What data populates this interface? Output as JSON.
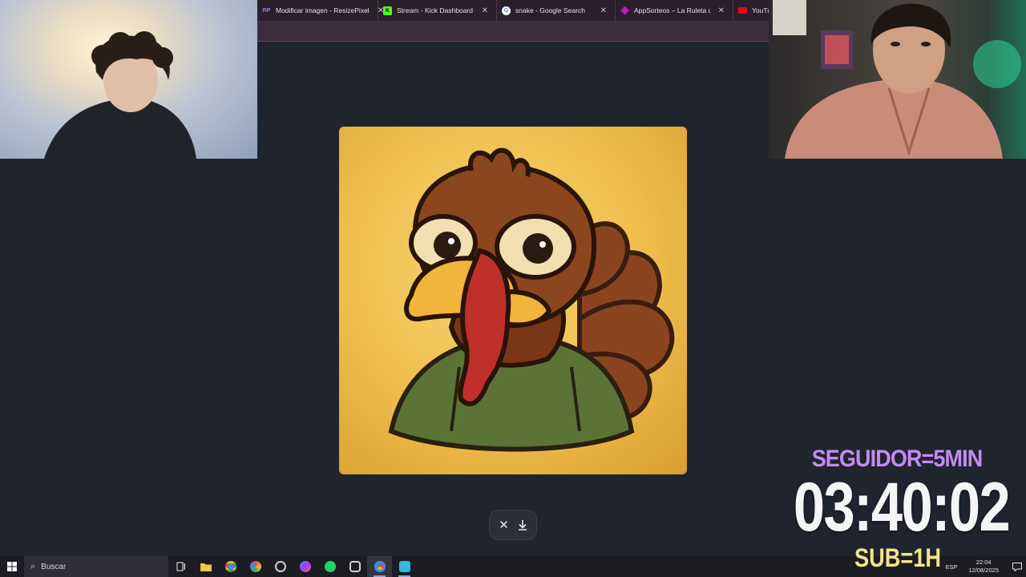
{
  "browser": {
    "tabs": [
      {
        "label": "Modificar imagen - ResizePixel",
        "favicon": "RP",
        "color": "#5b6ee1"
      },
      {
        "label": "Stream - Kick Dashboard",
        "favicon": "K",
        "color": "#53fc18"
      },
      {
        "label": "snake - Google Search",
        "favicon": "G",
        "color": "#ffffff"
      },
      {
        "label": "AppSorteos – La Ruleta de la S",
        "favicon": "",
        "color": "#b81fb0"
      },
      {
        "label": "YouTube",
        "favicon": "",
        "color": "#ff0000"
      }
    ]
  },
  "overlay": {
    "follower_rule": "SEGUIDOR=5MIN",
    "timer": "03:40:02",
    "sub_rule": "SUB=1H"
  },
  "taskbar": {
    "search_placeholder": "Buscar",
    "language": "ESP",
    "time": "22:04",
    "date": "12/08/2025",
    "apps": [
      {
        "icon": "task-view-icon",
        "color": "#cfcfcf"
      },
      {
        "icon": "file-explorer-icon",
        "color": "#f2c744"
      },
      {
        "icon": "chrome-icon",
        "color": "#4caf50"
      },
      {
        "icon": "photos-icon",
        "color": "#e84a5f"
      },
      {
        "icon": "obs-icon",
        "color": "#d0d0d0"
      },
      {
        "icon": "messenger-icon",
        "color": "#9a5cf5"
      },
      {
        "icon": "spotify-icon",
        "color": "#1ed760"
      },
      {
        "icon": "streamlabs-icon",
        "color": "#cfcfcf"
      },
      {
        "icon": "chrome-active-icon",
        "color": "#4caf50"
      },
      {
        "icon": "app-icon",
        "color": "#33b6e0"
      }
    ]
  }
}
